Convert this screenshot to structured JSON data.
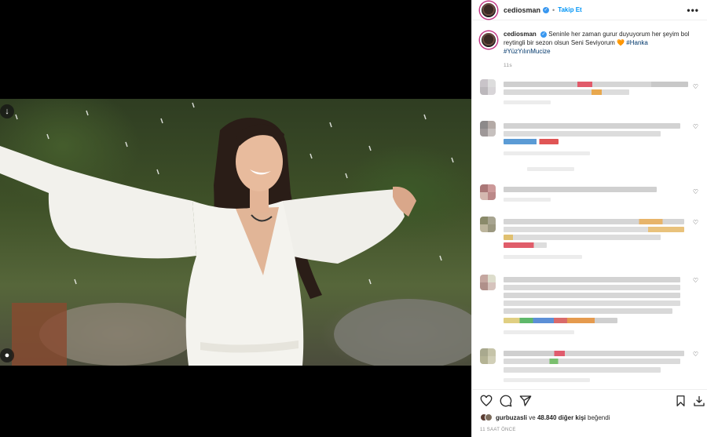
{
  "post": {
    "username": "cediosman",
    "verified_badge": "✓",
    "dot": "•",
    "follow_label": "Takip Et",
    "more_label": "•••"
  },
  "caption": {
    "username": "cediosman",
    "text": "Seninle her zaman gurur duyuyorum her şeyim bol reytingli bir sezon olsun Seni Seviyorum 🧡",
    "hashtag1": "#Hanka",
    "hashtag2": "#YüzYılınMucize",
    "time": "11s"
  },
  "actions": {
    "like_icon": "heart-icon",
    "comment_icon": "comment-icon",
    "share_icon": "send-icon",
    "save_icon": "bookmark-icon",
    "download_icon": "download-icon"
  },
  "likes": {
    "first_user": "gurbuzasli",
    "connector": "ve",
    "count_text": "48.840 diğer kişi",
    "suffix": "beğendi"
  },
  "time_ago": "11 SAAT ÖNCE",
  "colors": {
    "accent": "#0095f6",
    "verified": "#3897f0",
    "text": "#262626",
    "muted": "#8e8e8e"
  }
}
